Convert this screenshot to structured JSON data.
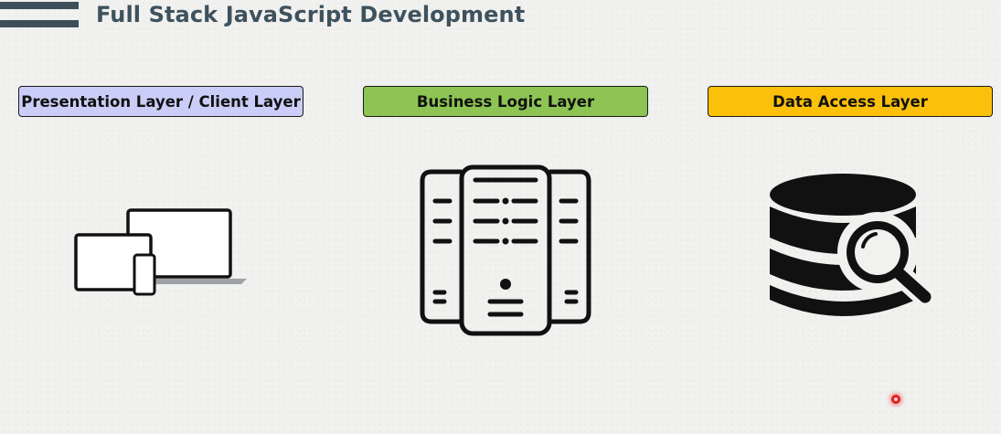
{
  "header": {
    "title": "Full Stack JavaScript Development"
  },
  "layers": [
    {
      "label": "Presentation Layer / Client Layer",
      "color": "#c9cdf7",
      "icon": "devices-icon"
    },
    {
      "label": "Business Logic Layer",
      "color": "#8dc453",
      "icon": "server-icon"
    },
    {
      "label": "Data Access Layer",
      "color": "#fbc00a",
      "icon": "database-search-icon"
    }
  ],
  "colors": {
    "title": "#3e525e",
    "menu_bars": "#3d4f5b",
    "icon": "#111111"
  }
}
